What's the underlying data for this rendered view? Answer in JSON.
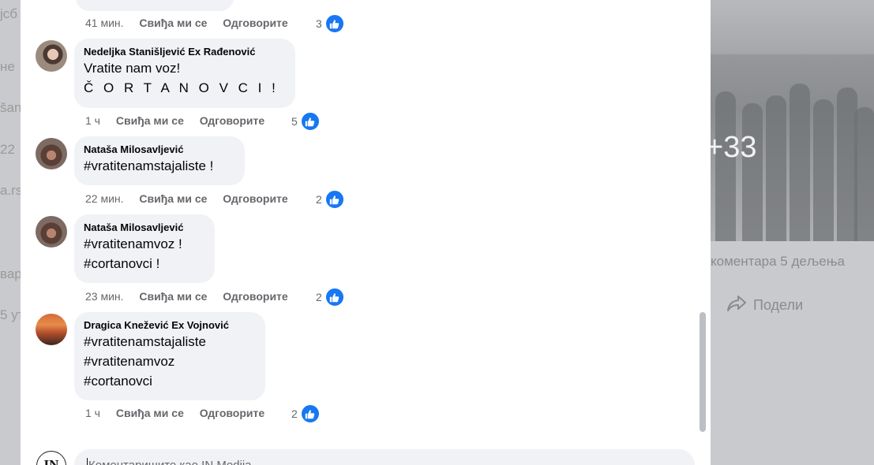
{
  "background": {
    "left_fragments": [
      "jcб",
      "не",
      "šan",
      "22",
      "a.rs",
      "вар",
      "5 ут"
    ],
    "overlay_plus": "+33",
    "post_meta": "коментара   5 дељења",
    "share_label": "Подели"
  },
  "previous_comment": {
    "time": "41 мин.",
    "like_label": "Свиђа ми се",
    "reply_label": "Одговорите",
    "reaction_count": "3"
  },
  "comments": [
    {
      "author": "Nedeljka Stanišljević Ex Rađenović",
      "lines": [
        "Vratite nam voz!",
        "Č O R T A N O V C I !"
      ],
      "time": "1 ч",
      "like_label": "Свиђа ми се",
      "reply_label": "Одговорите",
      "reaction_count": "5"
    },
    {
      "author": "Nataša Milosavljević",
      "lines": [
        "#vratitenamstajaliste !"
      ],
      "time": "22 мин.",
      "like_label": "Свиђа ми се",
      "reply_label": "Одговорите",
      "reaction_count": "2"
    },
    {
      "author": "Nataša Milosavljević",
      "lines": [
        "#vratitenamvoz !",
        "#cortanovci !"
      ],
      "time": "23 мин.",
      "like_label": "Свиђа ми се",
      "reply_label": "Одговорите",
      "reaction_count": "2"
    },
    {
      "author": "Dragica Knežević Ex Vojnović",
      "lines": [
        "#vratitenamstajaliste",
        "#vratitenamvoz",
        "#cortanovci"
      ],
      "time": "1 ч",
      "like_label": "Свиђа ми се",
      "reply_label": "Одговорите",
      "reaction_count": "2"
    }
  ],
  "composer": {
    "avatar_text": "IN",
    "placeholder": "Коментаришите као IN Medija"
  },
  "colors": {
    "like_blue": "#1877f2",
    "bubble_bg": "#f0f2f5",
    "meta_gray": "#65676b"
  }
}
